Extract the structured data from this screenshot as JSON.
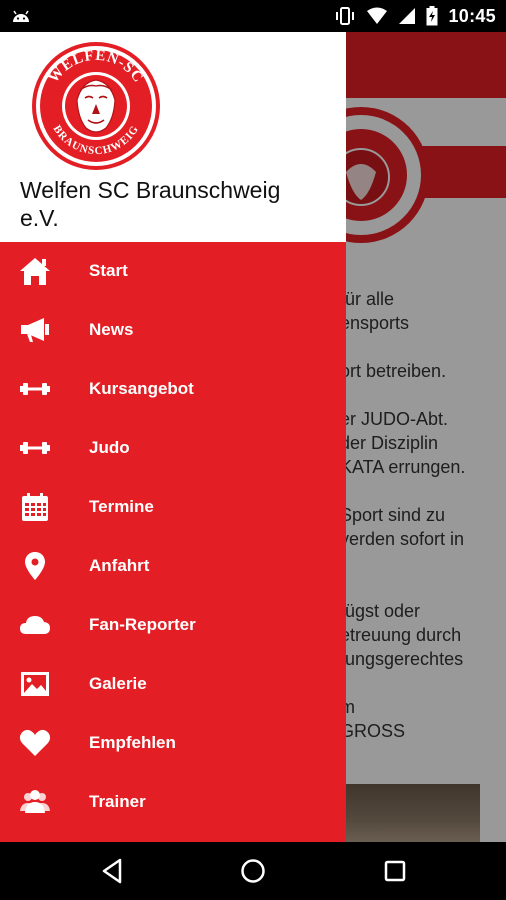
{
  "status_bar": {
    "time": "10:45",
    "icons": [
      "android-icon",
      "vibrate-icon",
      "wifi-icon",
      "signal-icon",
      "battery-charging-icon"
    ]
  },
  "background": {
    "lines": [
      "für alle",
      "ensports",
      "",
      "ort betreiben.",
      "",
      "er JUDO-Abt.",
      "der Disziplin",
      "KATA errungen.",
      "",
      "Sport sind zu",
      "verden sofort in",
      "",
      "",
      "fügst oder",
      "etreuung durch",
      "tungsgerechtes",
      "",
      "m",
      "GROSS"
    ]
  },
  "drawer": {
    "logo": {
      "name": "welfen-sc-logo",
      "text_top": "WELFEN-SC",
      "text_bottom": "BRAUNSCHWEIG"
    },
    "title": "Welfen SC Braunschweig e.V.",
    "items": [
      {
        "label": "Start",
        "icon": "home-icon"
      },
      {
        "label": "News",
        "icon": "megaphone-icon"
      },
      {
        "label": "Kursangebot",
        "icon": "dumbbell-icon"
      },
      {
        "label": "Judo",
        "icon": "dumbbell-icon"
      },
      {
        "label": "Termine",
        "icon": "calendar-icon"
      },
      {
        "label": "Anfahrt",
        "icon": "map-pin-icon"
      },
      {
        "label": "Fan-Reporter",
        "icon": "cloud-icon"
      },
      {
        "label": "Galerie",
        "icon": "image-icon"
      },
      {
        "label": "Empfehlen",
        "icon": "heart-icon"
      },
      {
        "label": "Trainer",
        "icon": "people-icon"
      }
    ]
  },
  "colors": {
    "brand_red": "#e31e24",
    "drawer_header": "#ffffff",
    "text_white": "#ffffff"
  },
  "nav_bar": {
    "buttons": [
      "back-icon",
      "home-circle-icon",
      "recents-icon"
    ]
  }
}
